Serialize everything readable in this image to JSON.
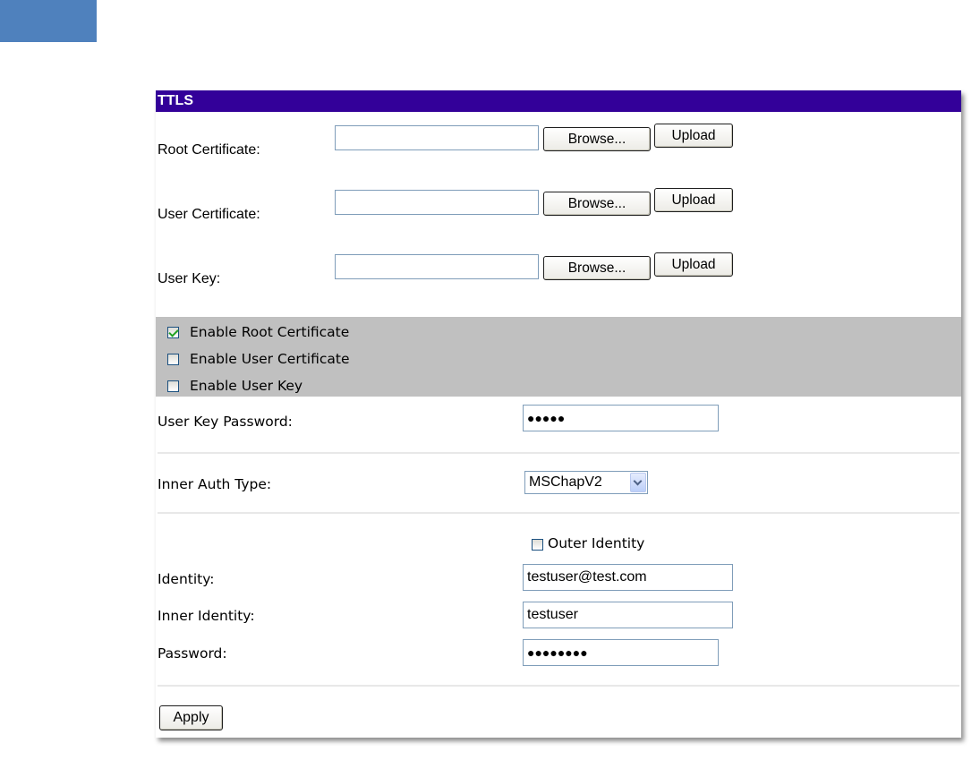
{
  "panel": {
    "title": "TTLS"
  },
  "certificates": [
    {
      "label": "Root Certificate:",
      "browse_label": "Browse...",
      "upload_label": "Upload"
    },
    {
      "label": "User Certificate:",
      "browse_label": "Browse...",
      "upload_label": "Upload"
    },
    {
      "label": "User Key:",
      "browse_label": "Browse...",
      "upload_label": "Upload"
    }
  ],
  "enable_options": [
    {
      "label": "Enable Root Certificate",
      "checked": true
    },
    {
      "label": "Enable User Certificate",
      "checked": false
    },
    {
      "label": "Enable User Key",
      "checked": false
    }
  ],
  "user_key_password": {
    "label": "User Key Password:",
    "value": "●●●●●"
  },
  "inner_auth": {
    "label": "Inner Auth Type:",
    "value": "MSChapV2"
  },
  "outer_identity": {
    "label": "Outer Identity",
    "checked": false
  },
  "identity": {
    "label": "Identity:",
    "value": "testuser@test.com"
  },
  "inner_identity": {
    "label": "Inner Identity:",
    "value": "testuser"
  },
  "password": {
    "label": "Password:",
    "value": "●●●●●●●●"
  },
  "apply_label": "Apply",
  "colors": {
    "title_bar": "#330099",
    "corner_block": "#4f81bd",
    "option_band": "#c0c0c0"
  }
}
